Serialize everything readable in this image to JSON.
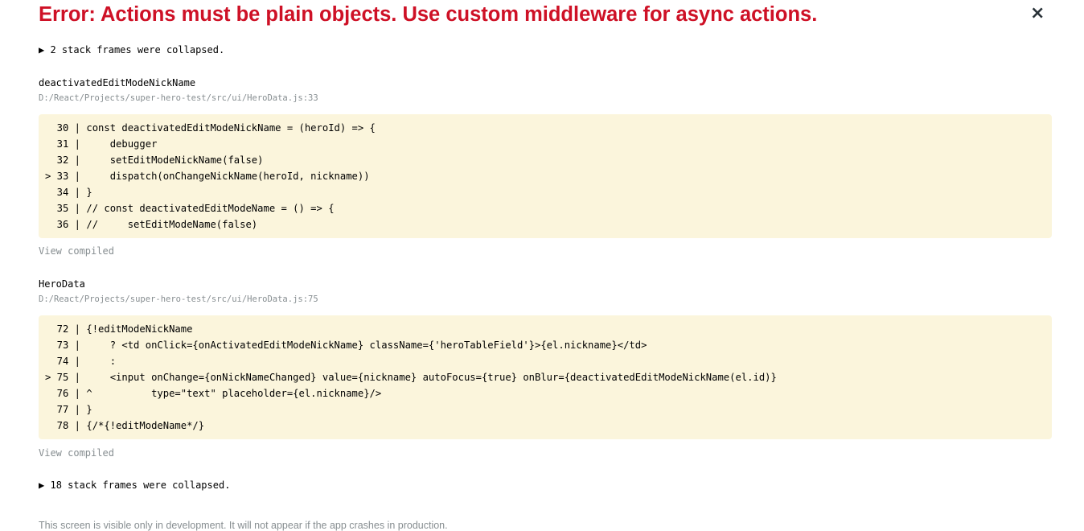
{
  "error": {
    "title": "Error: Actions must be plain objects. Use custom middleware for async actions.",
    "close_symbol": "×"
  },
  "collapsed_top": {
    "arrow": "▶",
    "label": "2 stack frames were collapsed."
  },
  "frames": [
    {
      "name": "deactivatedEditModeNickName",
      "path": "D:/React/Projects/super-hero-test/src/ui/HeroData.js:33",
      "lines": [
        "  30 | const deactivatedEditModeNickName = (heroId) => {",
        "  31 |     debugger",
        "  32 |     setEditModeNickName(false)",
        "> 33 |     dispatch(onChangeNickName(heroId, nickname))",
        "  34 | }",
        "  35 | // const deactivatedEditModeName = () => {",
        "  36 | //     setEditModeName(false)"
      ],
      "view_compiled": "View compiled"
    },
    {
      "name": "HeroData",
      "path": "D:/React/Projects/super-hero-test/src/ui/HeroData.js:75",
      "lines": [
        "  72 | {!editModeNickName",
        "  73 |     ? <td onClick={onActivatedEditModeNickName} className={'heroTableField'}>{el.nickname}</td>",
        "  74 |     :",
        "> 75 |     <input onChange={onNickNameChanged} value={nickname} autoFocus={true} onBlur={deactivatedEditModeNickName(el.id)}",
        "  76 | ^          type=\"text\" placeholder={el.nickname}/>",
        "  77 | }",
        "  78 | {/*{!editModeName*/}"
      ],
      "view_compiled": "View compiled"
    }
  ],
  "collapsed_bottom": {
    "arrow": "▶",
    "label": "18 stack frames were collapsed."
  },
  "footer": "This screen is visible only in development. It will not appear if the app crashes in production."
}
